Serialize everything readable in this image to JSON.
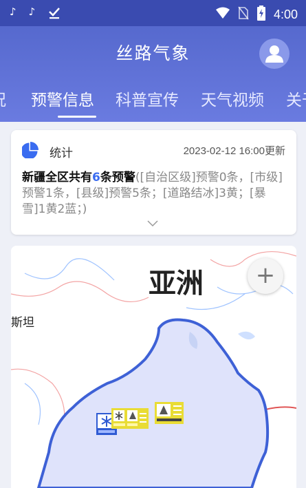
{
  "status_bar": {
    "icons": [
      "tiktok-icon",
      "tiktok-icon",
      "download-done-icon",
      "wifi-icon",
      "no-sim-icon",
      "battery-charging-icon"
    ],
    "time": "4:00"
  },
  "app": {
    "title": "丝路气象",
    "brand_color": "#5a6dd0"
  },
  "tabs": [
    {
      "label": "况",
      "active": false
    },
    {
      "label": "预警信息",
      "active": true
    },
    {
      "label": "科普宣传",
      "active": false
    },
    {
      "label": "天气视频",
      "active": false
    },
    {
      "label": "关于",
      "active": false
    }
  ],
  "stats_card": {
    "icon": "pie-chart-icon",
    "label": "统计",
    "updated": "2023-02-12 16:00更新",
    "summary_prefix": "新疆全区共有",
    "summary_count": "6",
    "summary_suffix": "条预警",
    "summary_detail": "([自治区级]预警0条，[市级]预警1条，[县级]预警5条；[道路结冰]3黄；[暴雪]1黄2蓝；)"
  },
  "map": {
    "continent_label": "亚洲",
    "country_label": "斯坦",
    "zoom_in_label": "+",
    "markers": [
      "blizzard-blue-warning",
      "blizzard-yellow-warning",
      "road-icing-yellow-warning",
      "road-icing-yellow-warning",
      "road-icing-yellow-warning"
    ]
  }
}
